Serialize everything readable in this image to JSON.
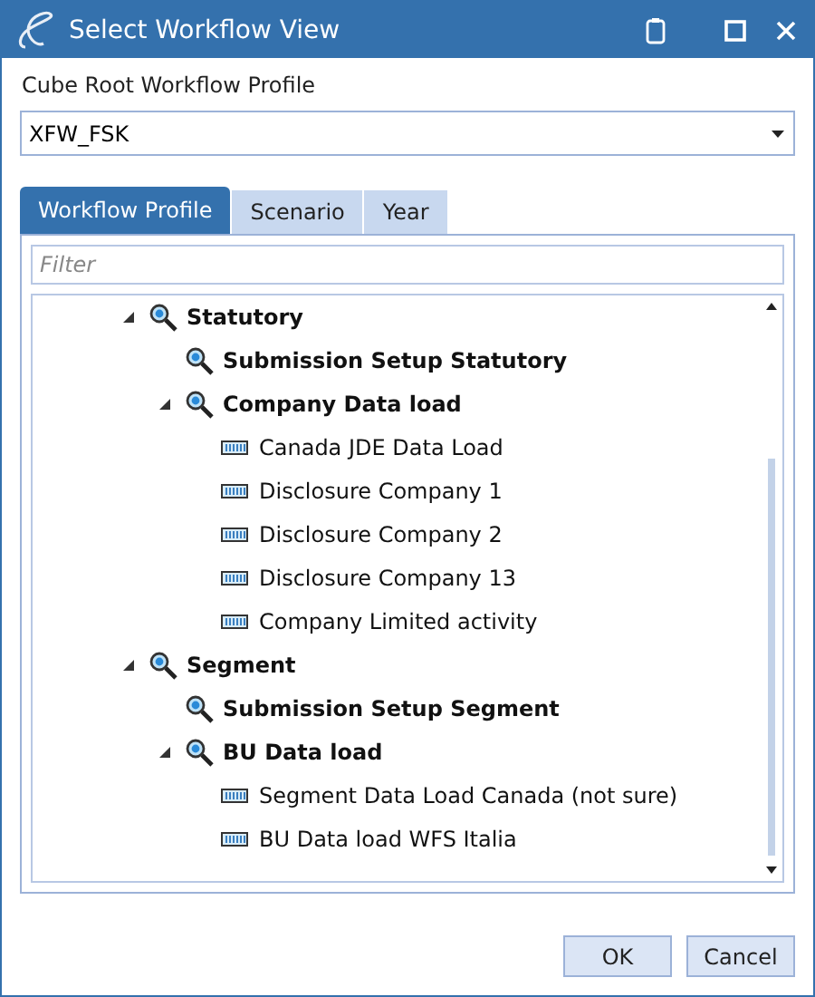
{
  "window": {
    "title": "Select Workflow View"
  },
  "profile_label": "Cube Root Workflow Profile",
  "profile_dropdown": {
    "value": "XFW_FSK"
  },
  "tabs": [
    {
      "label": "Workflow Profile",
      "selected": true
    },
    {
      "label": "Scenario",
      "selected": false
    },
    {
      "label": "Year",
      "selected": false
    }
  ],
  "filter": {
    "placeholder": "Filter"
  },
  "tree": [
    {
      "label": "Statutory",
      "kind": "group",
      "expanded": true,
      "children": [
        {
          "label": "Submission Setup Statutory",
          "kind": "group"
        },
        {
          "label": "Company Data load",
          "kind": "group",
          "expanded": true,
          "children": [
            {
              "label": "Canada JDE Data Load",
              "kind": "step"
            },
            {
              "label": "Disclosure Company 1",
              "kind": "step"
            },
            {
              "label": "Disclosure Company 2",
              "kind": "step"
            },
            {
              "label": "Disclosure Company 13",
              "kind": "step"
            },
            {
              "label": "Company Limited activity",
              "kind": "step"
            }
          ]
        }
      ]
    },
    {
      "label": "Segment",
      "kind": "group",
      "expanded": true,
      "children": [
        {
          "label": "Submission Setup Segment",
          "kind": "group"
        },
        {
          "label": "BU Data load",
          "kind": "group",
          "expanded": true,
          "children": [
            {
              "label": "Segment Data Load Canada (not sure)",
              "kind": "step"
            },
            {
              "label": "BU Data load WFS Italia",
              "kind": "step"
            }
          ]
        }
      ]
    }
  ],
  "buttons": [
    "OK",
    "Cancel"
  ]
}
